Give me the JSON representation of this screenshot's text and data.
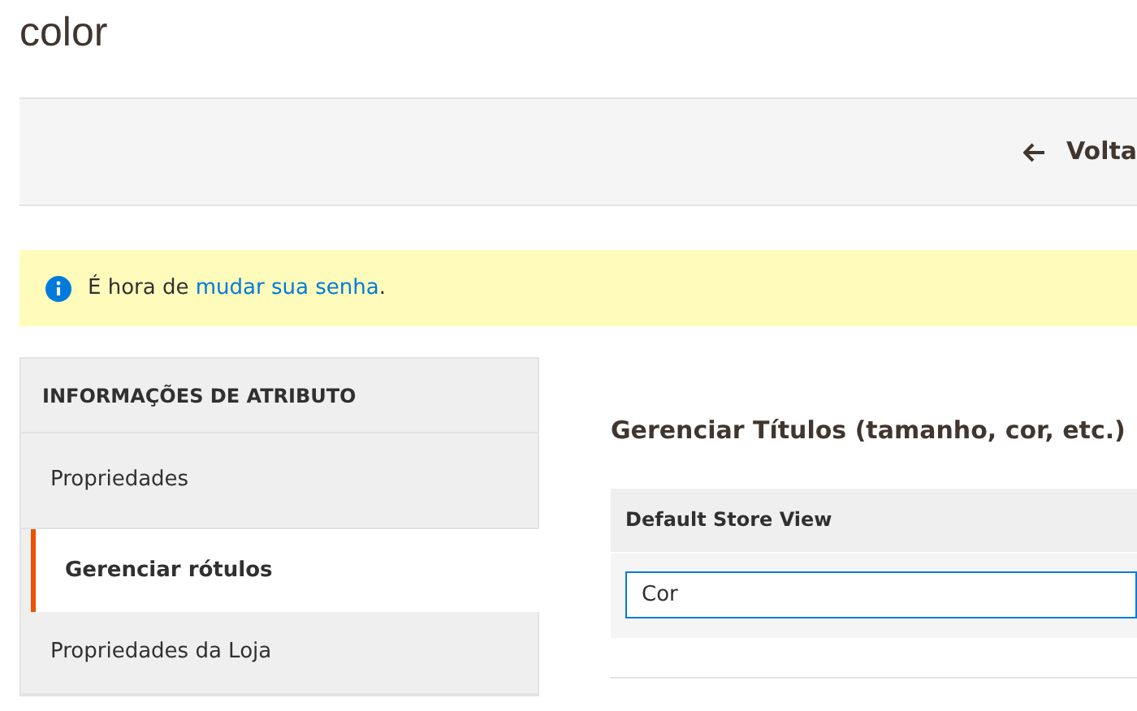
{
  "page_title": "color",
  "toolbar": {
    "back_button": {
      "label": "Volta"
    }
  },
  "notice": {
    "text_before": "É hora de",
    "link": "mudar sua senha",
    "text_after": "."
  },
  "sidebar": {
    "title": "INFORMAÇÕES DE ATRIBUTO",
    "items": [
      {
        "label": "Propriedades",
        "selected": false
      },
      {
        "label": "Gerenciar rótulos",
        "selected": true
      },
      {
        "label": "Propriedades da Loja",
        "selected": false
      }
    ]
  },
  "section": {
    "title": "Gerenciar Títulos (tamanho, cor, etc.)",
    "table": {
      "column_header": "Default Store View",
      "value": "Cor"
    }
  }
}
